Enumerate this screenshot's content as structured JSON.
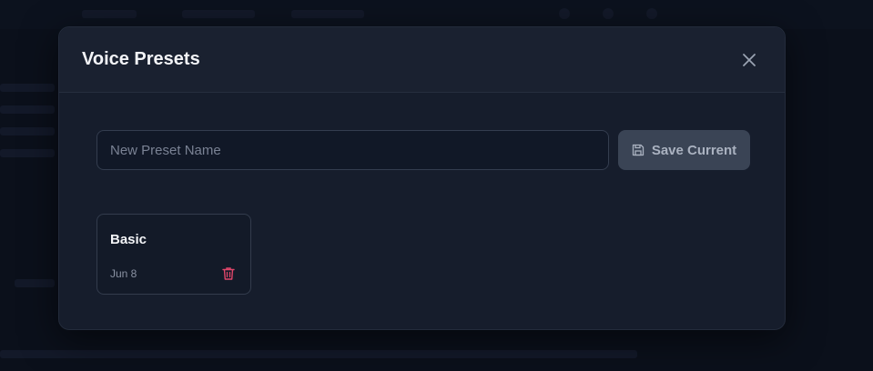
{
  "modal": {
    "title": "Voice Presets",
    "close_icon": "close-icon"
  },
  "form": {
    "name_placeholder": "New Preset Name",
    "name_value": "",
    "save_label": "Save Current",
    "save_icon": "floppy-disk-icon"
  },
  "presets": [
    {
      "name": "Basic",
      "date": "Jun 8",
      "delete_icon": "trash-icon"
    }
  ],
  "colors": {
    "modal_bg": "#161d2c",
    "delete_accent": "#e0466a",
    "button_bg": "#3a4455"
  }
}
